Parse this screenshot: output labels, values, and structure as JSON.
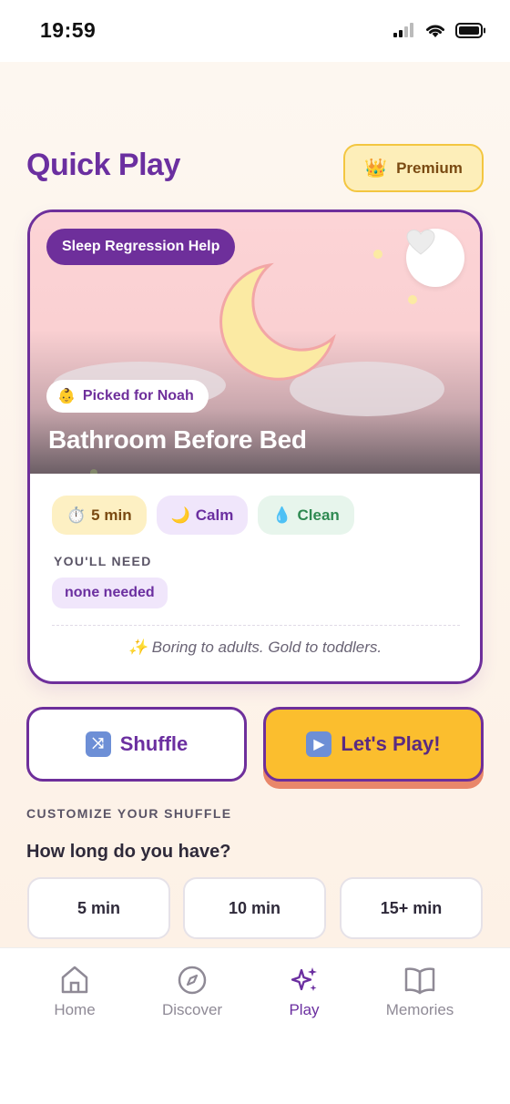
{
  "status": {
    "time": "19:59"
  },
  "header": {
    "title": "Quick Play",
    "premium_label": "Premium",
    "premium_icon": "crown-icon"
  },
  "card": {
    "tag": "Sleep Regression Help",
    "picked_for": "Picked for Noah",
    "title": "Bathroom Before Bed",
    "chips": [
      {
        "icon": "⏱️",
        "label": "5 min"
      },
      {
        "icon": "🌙",
        "label": "Calm"
      },
      {
        "icon": "💧",
        "label": "Clean"
      }
    ],
    "need_label": "YOU'LL NEED",
    "need_value": "none needed",
    "tagline_icon": "✨",
    "tagline": "Boring to adults. Gold to toddlers."
  },
  "actions": {
    "shuffle_label": "Shuffle",
    "play_label": "Let's Play!"
  },
  "customize": {
    "section_label": "CUSTOMIZE YOUR SHUFFLE",
    "question": "How long do you have?",
    "options": [
      "5 min",
      "10 min",
      "15+ min"
    ]
  },
  "nav": {
    "items": [
      {
        "label": "Home",
        "icon": "home-icon"
      },
      {
        "label": "Discover",
        "icon": "compass-icon"
      },
      {
        "label": "Play",
        "icon": "sparkles-icon",
        "active": true
      },
      {
        "label": "Memories",
        "icon": "book-icon"
      }
    ]
  },
  "colors": {
    "brand": "#6b2fa0",
    "accent": "#fbbe2e",
    "premium_bg": "#fdeeb9"
  }
}
